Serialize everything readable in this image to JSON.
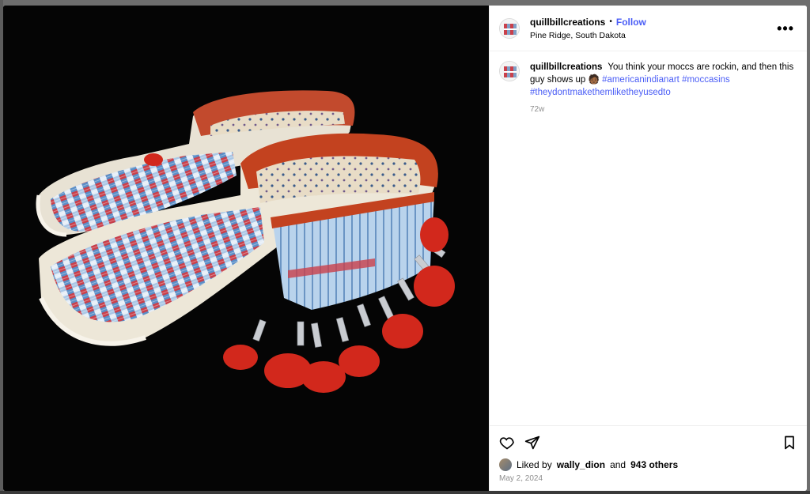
{
  "post": {
    "username": "quillbillcreations",
    "follow_label": "Follow",
    "separator": "•",
    "location": "Pine Ridge, South Dakota",
    "more_label": "•••",
    "caption_text": "You think your moccs are rockin, and then this guy shows up",
    "caption_emoji": "🧑🏾",
    "hashtags": [
      "#americanindianart",
      "#moccasins",
      "#theydontmakethemliketheyusedto"
    ],
    "time_ago": "72w",
    "liked_by_prefix": "Liked by",
    "liked_by_user": "wally_dion",
    "liked_by_and": "and",
    "liked_by_others": "943 others",
    "date": "May 2, 2024"
  },
  "image": {
    "subject": "quilled moccasins with red trim, silver cones and red feathers",
    "background_color": "#050505"
  },
  "icons": {
    "like": "heart-icon",
    "share": "paper-plane-icon",
    "save": "bookmark-icon"
  },
  "colors": {
    "link": "#4a5df6",
    "muted": "#8e8e8e"
  }
}
